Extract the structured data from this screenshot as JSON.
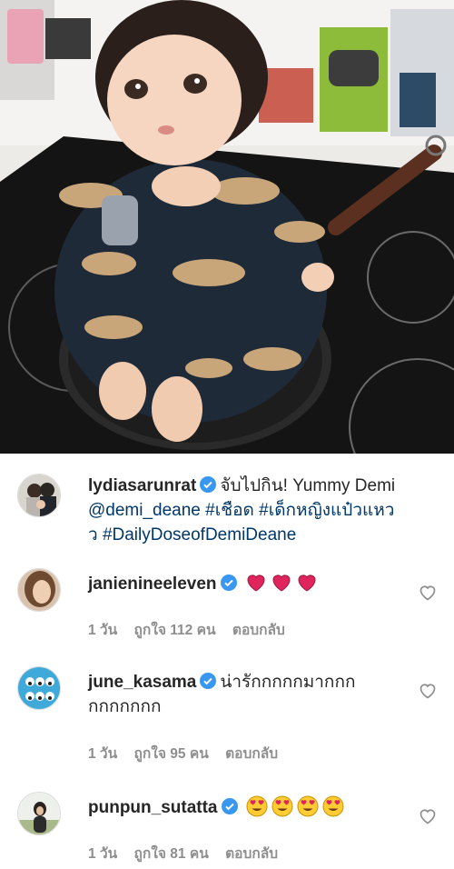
{
  "post": {
    "author": "lydiasarunrat",
    "caption_start": "จับไปกิน! Yummy Demi",
    "mention": "@demi_deane",
    "tags": [
      "#เชือด",
      "#เด็กหญิงแป๋วแหว",
      "ว",
      "#DailyDoseofDemiDeane"
    ]
  },
  "comments": [
    {
      "username": "janienineeleven",
      "text": "",
      "emojis": [
        "red-heart",
        "red-heart",
        "red-heart"
      ],
      "time": "1 วัน",
      "likes": "ถูกใจ 112 คน",
      "reply": "ตอบกลับ"
    },
    {
      "username": "june_kasama",
      "text_line1": "น่ารักกกกกมากกก",
      "text_line2": "กกกกกกก",
      "time": "1 วัน",
      "likes": "ถูกใจ 95 คน",
      "reply": "ตอบกลับ"
    },
    {
      "username": "punpun_sutatta",
      "emojis": [
        "heart-eyes",
        "heart-eyes",
        "heart-eyes",
        "heart-eyes"
      ],
      "time": "1 วัน",
      "likes": "ถูกใจ 81 คน",
      "reply": "ตอบกลับ"
    }
  ],
  "colors": {
    "verified": "#3897f0",
    "link": "#00376b",
    "meta": "#8e8e8e",
    "heart": "#e0245e"
  }
}
